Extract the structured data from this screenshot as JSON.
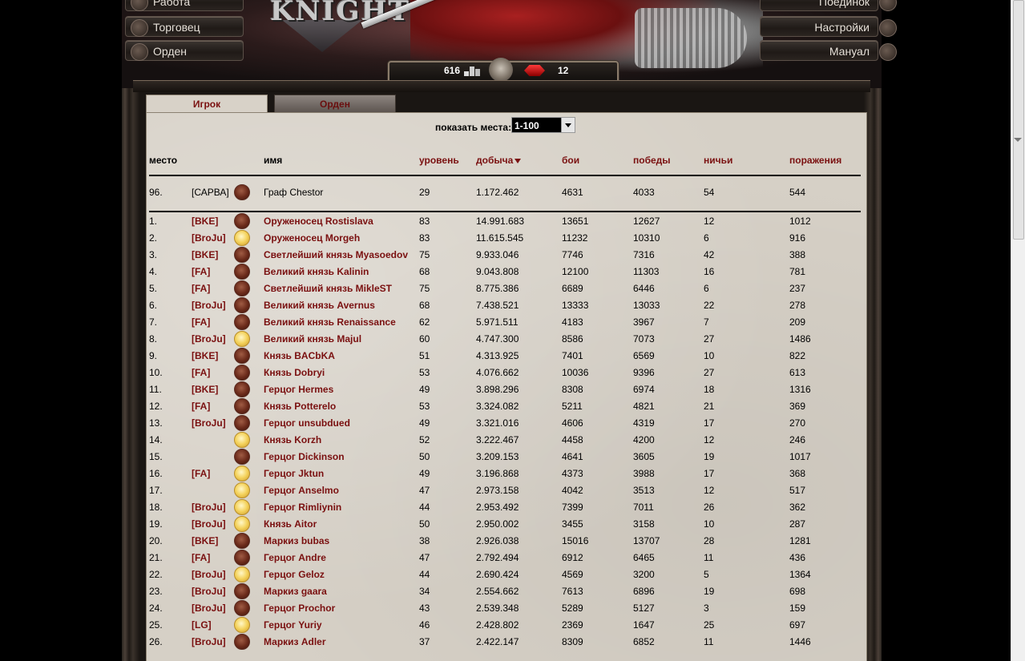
{
  "nav": {
    "left": [
      "Работа",
      "Торговец",
      "Орден"
    ],
    "right": [
      "Поединок",
      "Настройки",
      "Мануал"
    ]
  },
  "logo": "KNIGHT",
  "counters": {
    "silver": "616",
    "rubies": "12"
  },
  "tabs": [
    "Игрок",
    "Орден"
  ],
  "places": {
    "label": "показать места:",
    "selected": "1-100"
  },
  "columns": [
    "место",
    "имя",
    "уровень",
    "добыча",
    "бои",
    "победы",
    "ничьи",
    "поражения"
  ],
  "self": {
    "rank": "96.",
    "clan": "[САРВА]",
    "avatar": "red",
    "name": "Граф Chestor",
    "level": "29",
    "loot": "1.172.462",
    "fights": "4631",
    "wins": "4033",
    "draws": "54",
    "losses": "544"
  },
  "rows": [
    {
      "rank": "1.",
      "clan": "[BKE]",
      "avatar": "red",
      "name": "Оруженосец Rostislava",
      "level": "83",
      "loot": "14.991.683",
      "fights": "13651",
      "wins": "12627",
      "draws": "12",
      "losses": "1012"
    },
    {
      "rank": "2.",
      "clan": "[BroJu]",
      "avatar": "gold",
      "name": "Оруженосец Morgeh",
      "level": "83",
      "loot": "11.615.545",
      "fights": "11232",
      "wins": "10310",
      "draws": "6",
      "losses": "916"
    },
    {
      "rank": "3.",
      "clan": "[BKE]",
      "avatar": "red",
      "name": "Светлейший князь Myasoedov",
      "level": "75",
      "loot": "9.933.046",
      "fights": "7746",
      "wins": "7316",
      "draws": "42",
      "losses": "388"
    },
    {
      "rank": "4.",
      "clan": "[FA]",
      "avatar": "red",
      "name": "Великий князь Kalinin",
      "level": "68",
      "loot": "9.043.808",
      "fights": "12100",
      "wins": "11303",
      "draws": "16",
      "losses": "781"
    },
    {
      "rank": "5.",
      "clan": "[FA]",
      "avatar": "red",
      "name": "Светлейший князь MikleST",
      "level": "75",
      "loot": "8.775.386",
      "fights": "6689",
      "wins": "6446",
      "draws": "6",
      "losses": "237"
    },
    {
      "rank": "6.",
      "clan": "[BroJu]",
      "avatar": "red",
      "name": "Великий князь Avernus",
      "level": "68",
      "loot": "7.438.521",
      "fights": "13333",
      "wins": "13033",
      "draws": "22",
      "losses": "278"
    },
    {
      "rank": "7.",
      "clan": "[FA]",
      "avatar": "red",
      "name": "Великий князь Renaissance",
      "level": "62",
      "loot": "5.971.511",
      "fights": "4183",
      "wins": "3967",
      "draws": "7",
      "losses": "209"
    },
    {
      "rank": "8.",
      "clan": "[BroJu]",
      "avatar": "gold",
      "name": "Великий князь Majul",
      "level": "60",
      "loot": "4.747.300",
      "fights": "8586",
      "wins": "7073",
      "draws": "27",
      "losses": "1486"
    },
    {
      "rank": "9.",
      "clan": "[BKE]",
      "avatar": "red",
      "name": "Князь BACbKA",
      "level": "51",
      "loot": "4.313.925",
      "fights": "7401",
      "wins": "6569",
      "draws": "10",
      "losses": "822"
    },
    {
      "rank": "10.",
      "clan": "[FA]",
      "avatar": "red",
      "name": "Князь Dobryi",
      "level": "53",
      "loot": "4.076.662",
      "fights": "10036",
      "wins": "9396",
      "draws": "27",
      "losses": "613"
    },
    {
      "rank": "11.",
      "clan": "[BKE]",
      "avatar": "red",
      "name": "Герцог Hermes",
      "level": "49",
      "loot": "3.898.296",
      "fights": "8308",
      "wins": "6974",
      "draws": "18",
      "losses": "1316"
    },
    {
      "rank": "12.",
      "clan": "[FA]",
      "avatar": "red",
      "name": "Князь Potterelo",
      "level": "53",
      "loot": "3.324.082",
      "fights": "5211",
      "wins": "4821",
      "draws": "21",
      "losses": "369"
    },
    {
      "rank": "13.",
      "clan": "[BroJu]",
      "avatar": "red",
      "name": "Герцог unsubdued",
      "level": "49",
      "loot": "3.321.016",
      "fights": "4606",
      "wins": "4319",
      "draws": "17",
      "losses": "270"
    },
    {
      "rank": "14.",
      "clan": "",
      "avatar": "gold",
      "name": "Князь Korzh",
      "level": "52",
      "loot": "3.222.467",
      "fights": "4458",
      "wins": "4200",
      "draws": "12",
      "losses": "246"
    },
    {
      "rank": "15.",
      "clan": "",
      "avatar": "red",
      "name": "Герцог Dickinson",
      "level": "50",
      "loot": "3.209.153",
      "fights": "4641",
      "wins": "3605",
      "draws": "19",
      "losses": "1017"
    },
    {
      "rank": "16.",
      "clan": "[FA]",
      "avatar": "gold",
      "name": "Герцог Jktun",
      "level": "49",
      "loot": "3.196.868",
      "fights": "4373",
      "wins": "3988",
      "draws": "17",
      "losses": "368"
    },
    {
      "rank": "17.",
      "clan": "",
      "avatar": "gold",
      "name": "Герцог Anselmo",
      "level": "47",
      "loot": "2.973.158",
      "fights": "4042",
      "wins": "3513",
      "draws": "12",
      "losses": "517"
    },
    {
      "rank": "18.",
      "clan": "[BroJu]",
      "avatar": "gold",
      "name": "Герцог Rimliynin",
      "level": "44",
      "loot": "2.953.492",
      "fights": "7399",
      "wins": "7011",
      "draws": "26",
      "losses": "362"
    },
    {
      "rank": "19.",
      "clan": "[BroJu]",
      "avatar": "gold",
      "name": "Князь Aitor",
      "level": "50",
      "loot": "2.950.002",
      "fights": "3455",
      "wins": "3158",
      "draws": "10",
      "losses": "287"
    },
    {
      "rank": "20.",
      "clan": "[BKE]",
      "avatar": "red",
      "name": "Маркиз bubas",
      "level": "38",
      "loot": "2.926.038",
      "fights": "15016",
      "wins": "13707",
      "draws": "28",
      "losses": "1281"
    },
    {
      "rank": "21.",
      "clan": "[FA]",
      "avatar": "red",
      "name": "Герцог Andre",
      "level": "47",
      "loot": "2.792.494",
      "fights": "6912",
      "wins": "6465",
      "draws": "11",
      "losses": "436"
    },
    {
      "rank": "22.",
      "clan": "[BroJu]",
      "avatar": "gold",
      "name": "Герцог Geloz",
      "level": "44",
      "loot": "2.690.424",
      "fights": "4569",
      "wins": "3200",
      "draws": "5",
      "losses": "1364"
    },
    {
      "rank": "23.",
      "clan": "[BroJu]",
      "avatar": "red",
      "name": "Маркиз gaara",
      "level": "34",
      "loot": "2.554.662",
      "fights": "7613",
      "wins": "6896",
      "draws": "19",
      "losses": "698"
    },
    {
      "rank": "24.",
      "clan": "[BroJu]",
      "avatar": "red",
      "name": "Герцог Prochor",
      "level": "43",
      "loot": "2.539.348",
      "fights": "5289",
      "wins": "5127",
      "draws": "3",
      "losses": "159"
    },
    {
      "rank": "25.",
      "clan": "[LG]",
      "avatar": "gold",
      "name": "Герцог Yuriy",
      "level": "46",
      "loot": "2.428.802",
      "fights": "2369",
      "wins": "1647",
      "draws": "25",
      "losses": "697"
    },
    {
      "rank": "26.",
      "clan": "[BroJu]",
      "avatar": "red",
      "name": "Маркиз Adler",
      "level": "37",
      "loot": "2.422.147",
      "fights": "8309",
      "wins": "6852",
      "draws": "11",
      "losses": "1446"
    }
  ]
}
